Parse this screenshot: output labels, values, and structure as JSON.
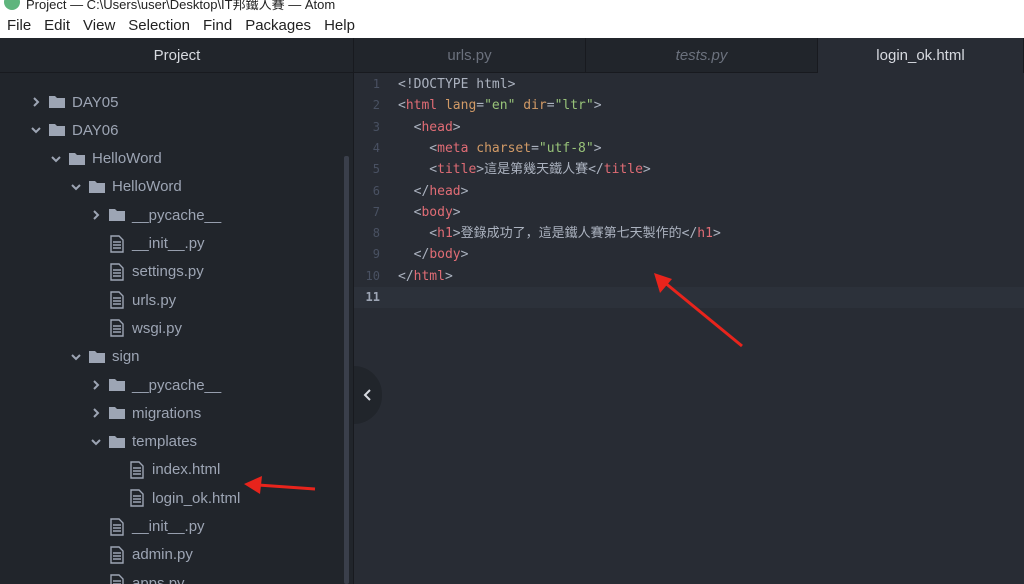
{
  "window": {
    "title": "Project — C:\\Users\\user\\Desktop\\IT邦鐵人賽 — Atom"
  },
  "menu": [
    "File",
    "Edit",
    "View",
    "Selection",
    "Find",
    "Packages",
    "Help"
  ],
  "sidebar": {
    "title": "Project",
    "tree": [
      {
        "label": "DAY05",
        "type": "folder",
        "expanded": false,
        "depth": 0
      },
      {
        "label": "DAY06",
        "type": "folder",
        "expanded": true,
        "depth": 0
      },
      {
        "label": "HelloWord",
        "type": "folder",
        "expanded": true,
        "depth": 1
      },
      {
        "label": "HelloWord",
        "type": "folder",
        "expanded": true,
        "depth": 2
      },
      {
        "label": "__pycache__",
        "type": "folder",
        "expanded": false,
        "depth": 3
      },
      {
        "label": "__init__.py",
        "type": "file",
        "depth": 3
      },
      {
        "label": "settings.py",
        "type": "file",
        "depth": 3
      },
      {
        "label": "urls.py",
        "type": "file",
        "depth": 3
      },
      {
        "label": "wsgi.py",
        "type": "file",
        "depth": 3
      },
      {
        "label": "sign",
        "type": "folder",
        "expanded": true,
        "depth": 2
      },
      {
        "label": "__pycache__",
        "type": "folder",
        "expanded": false,
        "depth": 3
      },
      {
        "label": "migrations",
        "type": "folder",
        "expanded": false,
        "depth": 3
      },
      {
        "label": "templates",
        "type": "folder",
        "expanded": true,
        "depth": 3
      },
      {
        "label": "index.html",
        "type": "file",
        "depth": 4
      },
      {
        "label": "login_ok.html",
        "type": "file",
        "depth": 4
      },
      {
        "label": "__init__.py",
        "type": "file",
        "depth": 3
      },
      {
        "label": "admin.py",
        "type": "file",
        "depth": 3
      },
      {
        "label": "apps.py",
        "type": "file",
        "depth": 3
      }
    ]
  },
  "tabs": [
    {
      "label": "urls.py",
      "italic": false,
      "active": false
    },
    {
      "label": "tests.py",
      "italic": true,
      "active": false
    },
    {
      "label": "login_ok.html",
      "italic": false,
      "active": true
    }
  ],
  "editor": {
    "current_line": 11,
    "lines": [
      [
        [
          "txt",
          "<!DOCTYPE html>"
        ]
      ],
      [
        [
          "txt",
          "<"
        ],
        [
          "tag",
          "html"
        ],
        [
          "txt",
          " "
        ],
        [
          "attr",
          "lang"
        ],
        [
          "txt",
          "="
        ],
        [
          "str",
          "\"en\""
        ],
        [
          "txt",
          " "
        ],
        [
          "attr",
          "dir"
        ],
        [
          "txt",
          "="
        ],
        [
          "str",
          "\"ltr\""
        ],
        [
          "txt",
          ">"
        ]
      ],
      [
        [
          "txt",
          "  <"
        ],
        [
          "tag",
          "head"
        ],
        [
          "txt",
          ">"
        ]
      ],
      [
        [
          "txt",
          "    <"
        ],
        [
          "tag",
          "meta"
        ],
        [
          "txt",
          " "
        ],
        [
          "attr",
          "charset"
        ],
        [
          "txt",
          "="
        ],
        [
          "str",
          "\"utf-8\""
        ],
        [
          "txt",
          ">"
        ]
      ],
      [
        [
          "txt",
          "    <"
        ],
        [
          "tag",
          "title"
        ],
        [
          "txt",
          ">這是第幾天鐵人賽</"
        ],
        [
          "tag",
          "title"
        ],
        [
          "txt",
          ">"
        ]
      ],
      [
        [
          "txt",
          "  </"
        ],
        [
          "tag",
          "head"
        ],
        [
          "txt",
          ">"
        ]
      ],
      [
        [
          "txt",
          "  <"
        ],
        [
          "tag",
          "body"
        ],
        [
          "txt",
          ">"
        ]
      ],
      [
        [
          "txt",
          "    <"
        ],
        [
          "tag",
          "h1"
        ],
        [
          "txt",
          ">登錄成功了，這是鐵人賽第七天製作的</"
        ],
        [
          "tag",
          "h1"
        ],
        [
          "txt",
          ">"
        ]
      ],
      [
        [
          "txt",
          "  </"
        ],
        [
          "tag",
          "body"
        ],
        [
          "txt",
          ">"
        ]
      ],
      [
        [
          "txt",
          "</"
        ],
        [
          "tag",
          "html"
        ],
        [
          "txt",
          ">"
        ]
      ],
      []
    ]
  },
  "colors": {
    "accent_arrow": "#e8241c",
    "folder_icon": "#9da5b4"
  },
  "icons": {
    "folder": "folder-icon",
    "file": "file-text-icon",
    "collapsed": "chevron-right-icon",
    "expanded": "chevron-down-icon",
    "collapse_panel": "chevron-left-icon"
  }
}
